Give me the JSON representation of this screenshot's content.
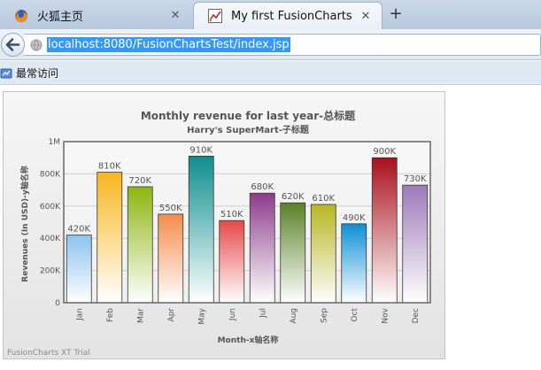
{
  "browser": {
    "tabs": [
      {
        "title": "火狐主页",
        "icon": "firefox-icon",
        "active": false
      },
      {
        "title": "My first FusionCharts",
        "icon": "fusioncharts-favicon-icon",
        "active": true
      }
    ],
    "tab_close_glyph": "✕",
    "new_tab_glyph": "+",
    "url": "localhost:8080/FusionChartsTest/index.jsp",
    "bookmarks": [
      {
        "label": "最常访问",
        "icon": "bookmark-icon"
      }
    ]
  },
  "watermark": "FusionCharts XT Trial",
  "colors": {
    "url_highlight": "#3399ff",
    "bar_colors": [
      "#8cc2ee",
      "#f7b61e",
      "#8db60e",
      "#f58c4a",
      "#0e8e8e",
      "#e44a4a",
      "#8c3c8c",
      "#5b8227",
      "#b8b520",
      "#0b8fd4",
      "#a9101c",
      "#9c7ab8"
    ]
  },
  "chart_data": {
    "type": "bar",
    "title": "Monthly revenue for last year-总标题",
    "subtitle": "Harry's SuperMart-子标题",
    "xlabel": "Month-x轴名称",
    "ylabel": "Revenues (In USD)-y轴名称",
    "categories": [
      "Jan",
      "Feb",
      "Mar",
      "Apr",
      "May",
      "Jun",
      "Jul",
      "Aug",
      "Sep",
      "Oct",
      "Nov",
      "Dec"
    ],
    "values": [
      420000,
      810000,
      720000,
      550000,
      910000,
      510000,
      680000,
      620000,
      610000,
      490000,
      900000,
      730000
    ],
    "value_labels": [
      "420K",
      "810K",
      "720K",
      "550K",
      "910K",
      "510K",
      "680K",
      "620K",
      "610K",
      "490K",
      "900K",
      "730K"
    ],
    "ylim": [
      0,
      1000000
    ],
    "yticks": [
      0,
      200000,
      400000,
      600000,
      800000,
      1000000
    ],
    "ytick_labels": [
      "0",
      "200K",
      "400K",
      "600K",
      "800K",
      "1M"
    ],
    "grid": true,
    "legend": "none"
  }
}
